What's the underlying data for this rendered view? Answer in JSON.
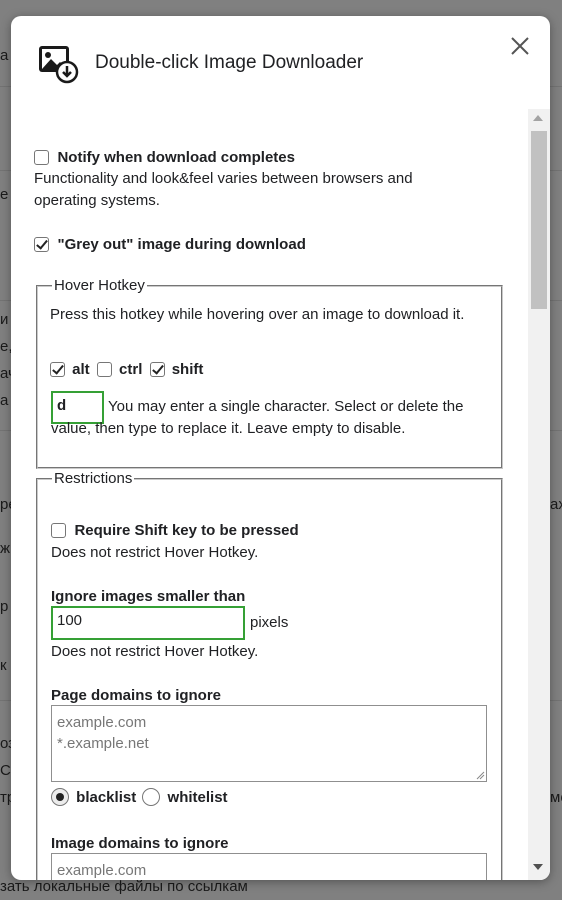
{
  "dialog": {
    "title": "Double-click Image Downloader",
    "close_icon": "close-icon",
    "app_icon": "image-download-icon"
  },
  "background": {
    "fragments": [
      "а",
      "е",
      "и",
      "е,",
      "ач",
      "а",
      "ре",
      "ах",
      "ж",
      "р",
      "к",
      "оз",
      "С",
      "тр",
      "ме"
    ],
    "bottom_text": "зать локальные файлы по ссылкам"
  },
  "notify": {
    "label": "Notify when download completes",
    "checked": false,
    "description": "Functionality and look&feel varies between browsers and operating systems."
  },
  "grey_out": {
    "label": "\"Grey out\" image during download",
    "checked": true
  },
  "hover_hotkey": {
    "legend": "Hover Hotkey",
    "description": "Press this hotkey while hovering over an image to download it.",
    "modifiers": [
      {
        "label": "alt",
        "checked": true
      },
      {
        "label": "ctrl",
        "checked": false
      },
      {
        "label": "shift",
        "checked": true
      }
    ],
    "key_value": "d",
    "key_help": "You may enter a single character. Select or delete the value, then type to replace it. Leave empty to disable."
  },
  "restrictions": {
    "legend": "Restrictions",
    "require_shift": {
      "label": "Require Shift key to be pressed",
      "checked": false,
      "note": "Does not restrict Hover Hotkey."
    },
    "min_size": {
      "label": "Ignore images smaller than",
      "value": "100",
      "unit": "pixels",
      "note": "Does not restrict Hover Hotkey."
    },
    "page_domains": {
      "label": "Page domains to ignore",
      "placeholder": "example.com\n*.example.net",
      "mode_options": [
        {
          "label": "blacklist",
          "checked": true
        },
        {
          "label": "whitelist",
          "checked": false
        }
      ]
    },
    "image_domains": {
      "label": "Image domains to ignore",
      "placeholder": "example.com\n*.example.net"
    }
  },
  "colors": {
    "accent_border": "#35a035",
    "overlay": "#808080"
  }
}
